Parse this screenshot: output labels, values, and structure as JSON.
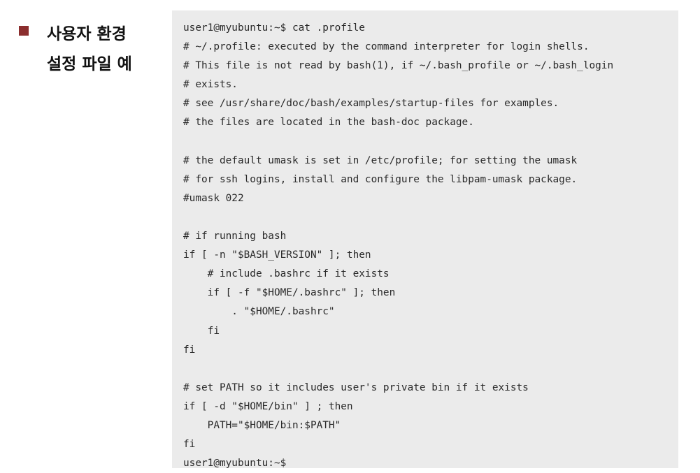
{
  "heading": {
    "line1": "사용자 환경",
    "line2": "설정 파일 예"
  },
  "colors": {
    "bullet": "#8b2e2e",
    "panel_background": "#ebebeb",
    "code_text": "#2a2a2a"
  },
  "terminal": {
    "lines": [
      "user1@myubuntu:~$ cat .profile",
      "# ~/.profile: executed by the command interpreter for login shells.",
      "# This file is not read by bash(1), if ~/.bash_profile or ~/.bash_login",
      "# exists.",
      "# see /usr/share/doc/bash/examples/startup-files for examples.",
      "# the files are located in the bash-doc package.",
      "",
      "# the default umask is set in /etc/profile; for setting the umask",
      "# for ssh logins, install and configure the libpam-umask package.",
      "#umask 022",
      "",
      "# if running bash",
      "if [ -n \"$BASH_VERSION\" ]; then",
      "    # include .bashrc if it exists",
      "    if [ -f \"$HOME/.bashrc\" ]; then",
      "        . \"$HOME/.bashrc\"",
      "    fi",
      "fi",
      "",
      "# set PATH so it includes user's private bin if it exists",
      "if [ -d \"$HOME/bin\" ] ; then",
      "    PATH=\"$HOME/bin:$PATH\"",
      "fi",
      "user1@myubuntu:~$"
    ]
  }
}
